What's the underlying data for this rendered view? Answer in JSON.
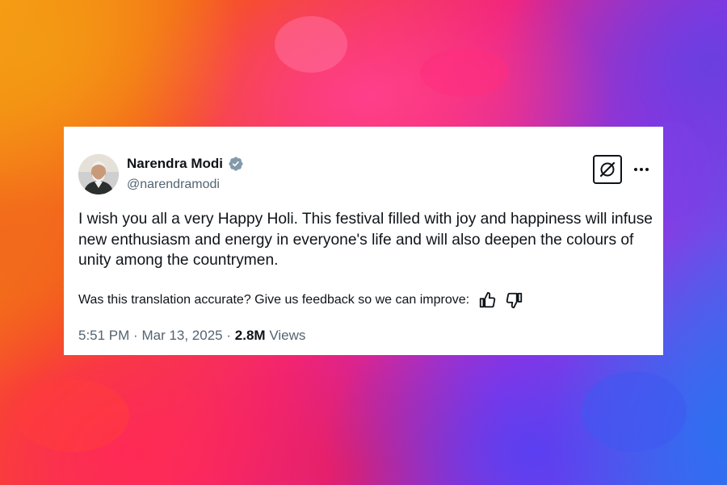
{
  "tweet": {
    "author_name": "Narendra Modi",
    "handle": "@narendramodi",
    "text": "I wish you all a very Happy Holi. This festival filled with joy and happiness will infuse new enthusiasm and energy in everyone's life and will also deepen the colours of unity among the countrymen.",
    "translation_feedback": "Was this translation accurate? Give us feedback so we can improve:",
    "time": "5:51 PM",
    "separator": "·",
    "date": "Mar 13, 2025",
    "views_count": "2.8M",
    "views_label": "Views"
  },
  "icons": {
    "verified": "verified-badge-icon",
    "x_logo": "x-logo-icon",
    "more": "more-options-icon",
    "thumbs_up": "thumbs-up-icon",
    "thumbs_down": "thumbs-down-icon"
  },
  "colors": {
    "verified": "#829aab",
    "text_primary": "#0f1419",
    "text_secondary": "#536471",
    "card_background": "#ffffff"
  }
}
